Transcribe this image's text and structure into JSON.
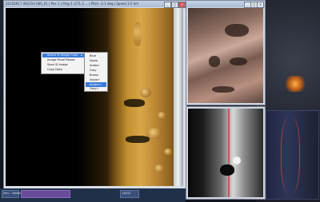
{
  "window": {
    "title": "20150917 092314 000_01 | Pos 1 | Ping 1 (271.2 ... | Pitch -2.1 deg | Speed 3.5 km",
    "btn_min": "_",
    "btn_max": "□",
    "btn_close": "×"
  },
  "context_menu": {
    "items": [
      {
        "label": "Select SI Image Color",
        "has_submenu": true
      },
      {
        "label": "Image Panel Resize"
      },
      {
        "label": "Save SI Image"
      },
      {
        "label": "Copy Data"
      }
    ],
    "arrow": "▸"
  },
  "color_submenu": {
    "items": [
      "Blue",
      "Sepia",
      "Amber",
      "Grey",
      "Brown",
      "Sepia+",
      "Amber+",
      "Grey+"
    ],
    "selected_index": 6
  },
  "side_windows": {
    "top_close": "×",
    "top_max": "□",
    "top_min": "_"
  },
  "taskbar": {
    "left_text": "Sen... Desktop",
    "small_label": "(A)G2"
  },
  "colors": {
    "menu_highlight": "#3b7ad8",
    "titlebar": "#a9bcd6"
  }
}
